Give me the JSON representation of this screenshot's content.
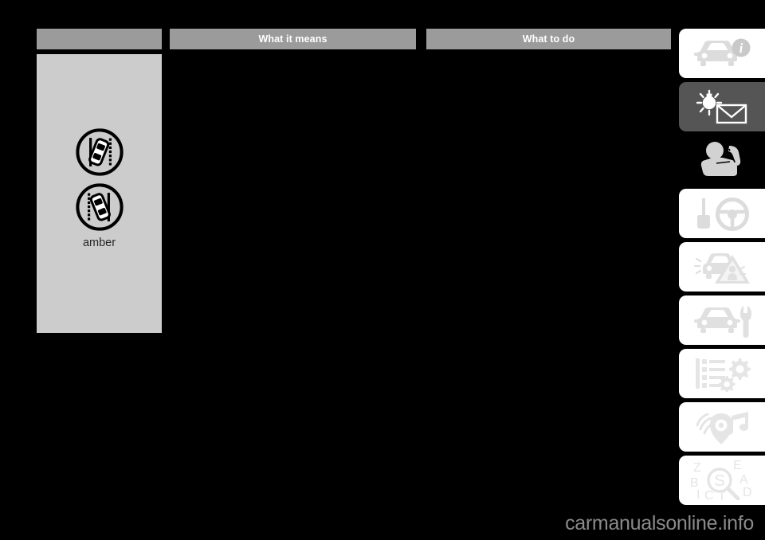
{
  "page": {
    "background_color": "#000000",
    "watermark": "carmanualsonline.info"
  },
  "table": {
    "headers": [
      {
        "label": "",
        "name": "warning-light-column-header"
      },
      {
        "label": "What it means",
        "name": "what-it-means-column-header"
      },
      {
        "label": "What to do",
        "name": "what-to-do-column-header"
      }
    ],
    "header_bg": "#9b9b9b",
    "header_text_color": "#ffffff",
    "row": {
      "warning_light": {
        "panel_bg": "#cccccc",
        "icons": [
          {
            "name": "lane-departure-warning-left-icon",
            "alt": "lane departure warning left"
          },
          {
            "name": "lane-departure-warning-right-icon",
            "alt": "lane departure warning right"
          }
        ],
        "color_label": "amber"
      },
      "what_it_means": "",
      "what_to_do": ""
    }
  },
  "sidebar": {
    "tabs": [
      {
        "name": "tab-vehicle-info",
        "icon": "car-info-icon",
        "style": "light"
      },
      {
        "name": "tab-warning-lamps",
        "icon": "lamp-envelope-icon",
        "style": "dark"
      },
      {
        "name": "tab-seats-restraints",
        "icon": "child-seatbelt-icon",
        "style": "black"
      },
      {
        "name": "tab-driving",
        "icon": "key-steering-wheel-icon",
        "style": "light"
      },
      {
        "name": "tab-emergencies",
        "icon": "car-warning-triangle-icon",
        "style": "light"
      },
      {
        "name": "tab-maintenance",
        "icon": "car-wrench-icon",
        "style": "light"
      },
      {
        "name": "tab-specifications",
        "icon": "list-gears-icon",
        "style": "light"
      },
      {
        "name": "tab-infotainment",
        "icon": "radio-music-note-icon",
        "style": "light"
      },
      {
        "name": "tab-index",
        "icon": "alphabet-magnifier-icon",
        "style": "light"
      }
    ]
  }
}
